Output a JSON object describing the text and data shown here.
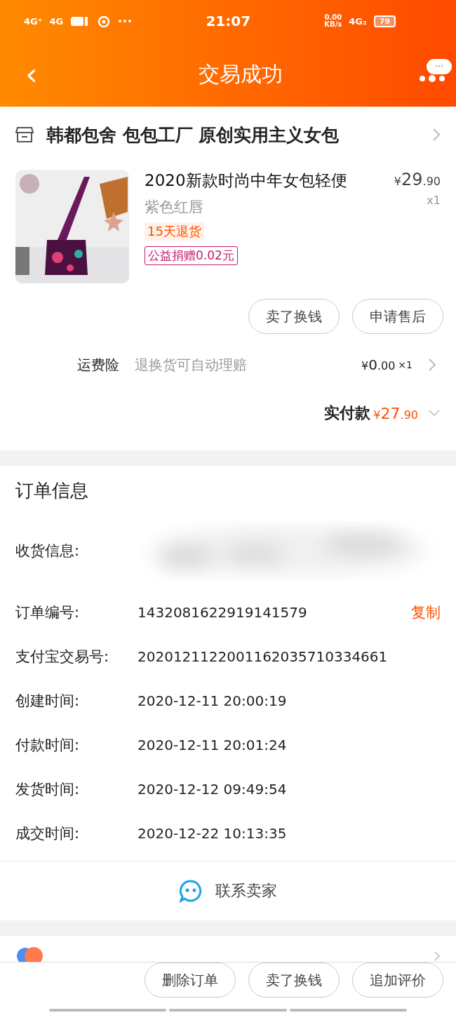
{
  "status_bar": {
    "left": [
      "4G⁺",
      "4G"
    ],
    "time": "21:07",
    "speed": "0.00",
    "speed_unit": "KB/s",
    "network": "4G₂",
    "battery": "79"
  },
  "nav": {
    "back": "‹",
    "title": "交易成功",
    "more": "···"
  },
  "shop": {
    "name": "韩都包舍 包包工厂 原创实用主义女包"
  },
  "product": {
    "kind": "picture",
    "title": "2020新款时尚中年女包轻便",
    "variant": "紫色红唇",
    "price": {
      "currency": "¥",
      "integer": "29",
      "decimal": ".90"
    },
    "quantity": "x1",
    "tags": [
      {
        "kind": "fill",
        "text": "15天退货"
      },
      {
        "kind": "outline",
        "text": "公益捐赠0.02元"
      }
    ]
  },
  "item_actions": [
    "卖了换钱",
    "申请售后"
  ],
  "insurance": {
    "label": "运费险",
    "desc": "退换货可自动理赔",
    "price": {
      "currency": "¥",
      "integer": "0",
      "decimal": ".00"
    },
    "quantity": "×1"
  },
  "total": {
    "label": "实付款",
    "price": {
      "currency": "¥",
      "integer": "27",
      "decimal": ".90"
    }
  },
  "order_info": {
    "title": "订单信息",
    "rows": [
      {
        "kind": "blurred",
        "label": "收货信息:"
      },
      {
        "kind": "copy",
        "label": "订单编号:",
        "value": "1432081622919141579",
        "action": "复制"
      },
      {
        "kind": "text",
        "label": "支付宝交易号:",
        "value": "2020121122001162035710334661"
      },
      {
        "kind": "text",
        "label": "创建时间:",
        "value": "2020-12-11 20:00:19"
      },
      {
        "kind": "text",
        "label": "付款时间:",
        "value": "2020-12-11 20:01:24"
      },
      {
        "kind": "text",
        "label": "发货时间:",
        "value": "2020-12-12 09:49:54"
      },
      {
        "kind": "text",
        "label": "成交时间:",
        "value": "2020-12-22 10:13:35"
      }
    ],
    "contact": "联系卖家"
  },
  "bottom_actions": [
    "删除订单",
    "卖了换钱",
    "追加评价"
  ]
}
